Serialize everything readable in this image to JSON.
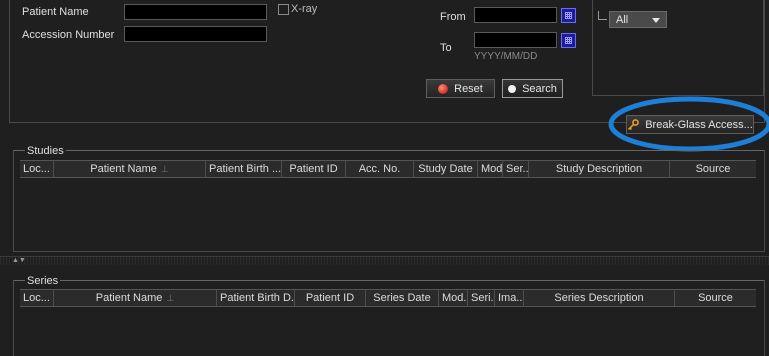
{
  "search": {
    "patient_name_label": "Patient Name",
    "accession_label": "Accession Number",
    "xray_label": "X-ray",
    "from_label": "From",
    "to_label": "To",
    "date_hint": "YYYY/MM/DD",
    "modality_select": "All",
    "reset_label": "Reset",
    "search_label": "Search"
  },
  "break_glass": {
    "label": "Break-Glass Access..."
  },
  "studies": {
    "title": "Studies",
    "columns": [
      "Loc...",
      "Patient Name",
      "Patient Birth ...",
      "Patient ID",
      "Acc. No.",
      "Study Date",
      "Mod...",
      "Ser...",
      "Study Description",
      "Source"
    ]
  },
  "series": {
    "title": "Series",
    "columns": [
      "Loc...",
      "Patient Name",
      "Patient Birth D...",
      "Patient ID",
      "Series Date",
      "Mod...",
      "Seri...",
      "Ima...",
      "Series Description",
      "Source"
    ]
  },
  "colors": {
    "highlight_ring": "#1d7fd6",
    "reset_icon": "#e03a2a",
    "key_icon": "#e0a020"
  }
}
